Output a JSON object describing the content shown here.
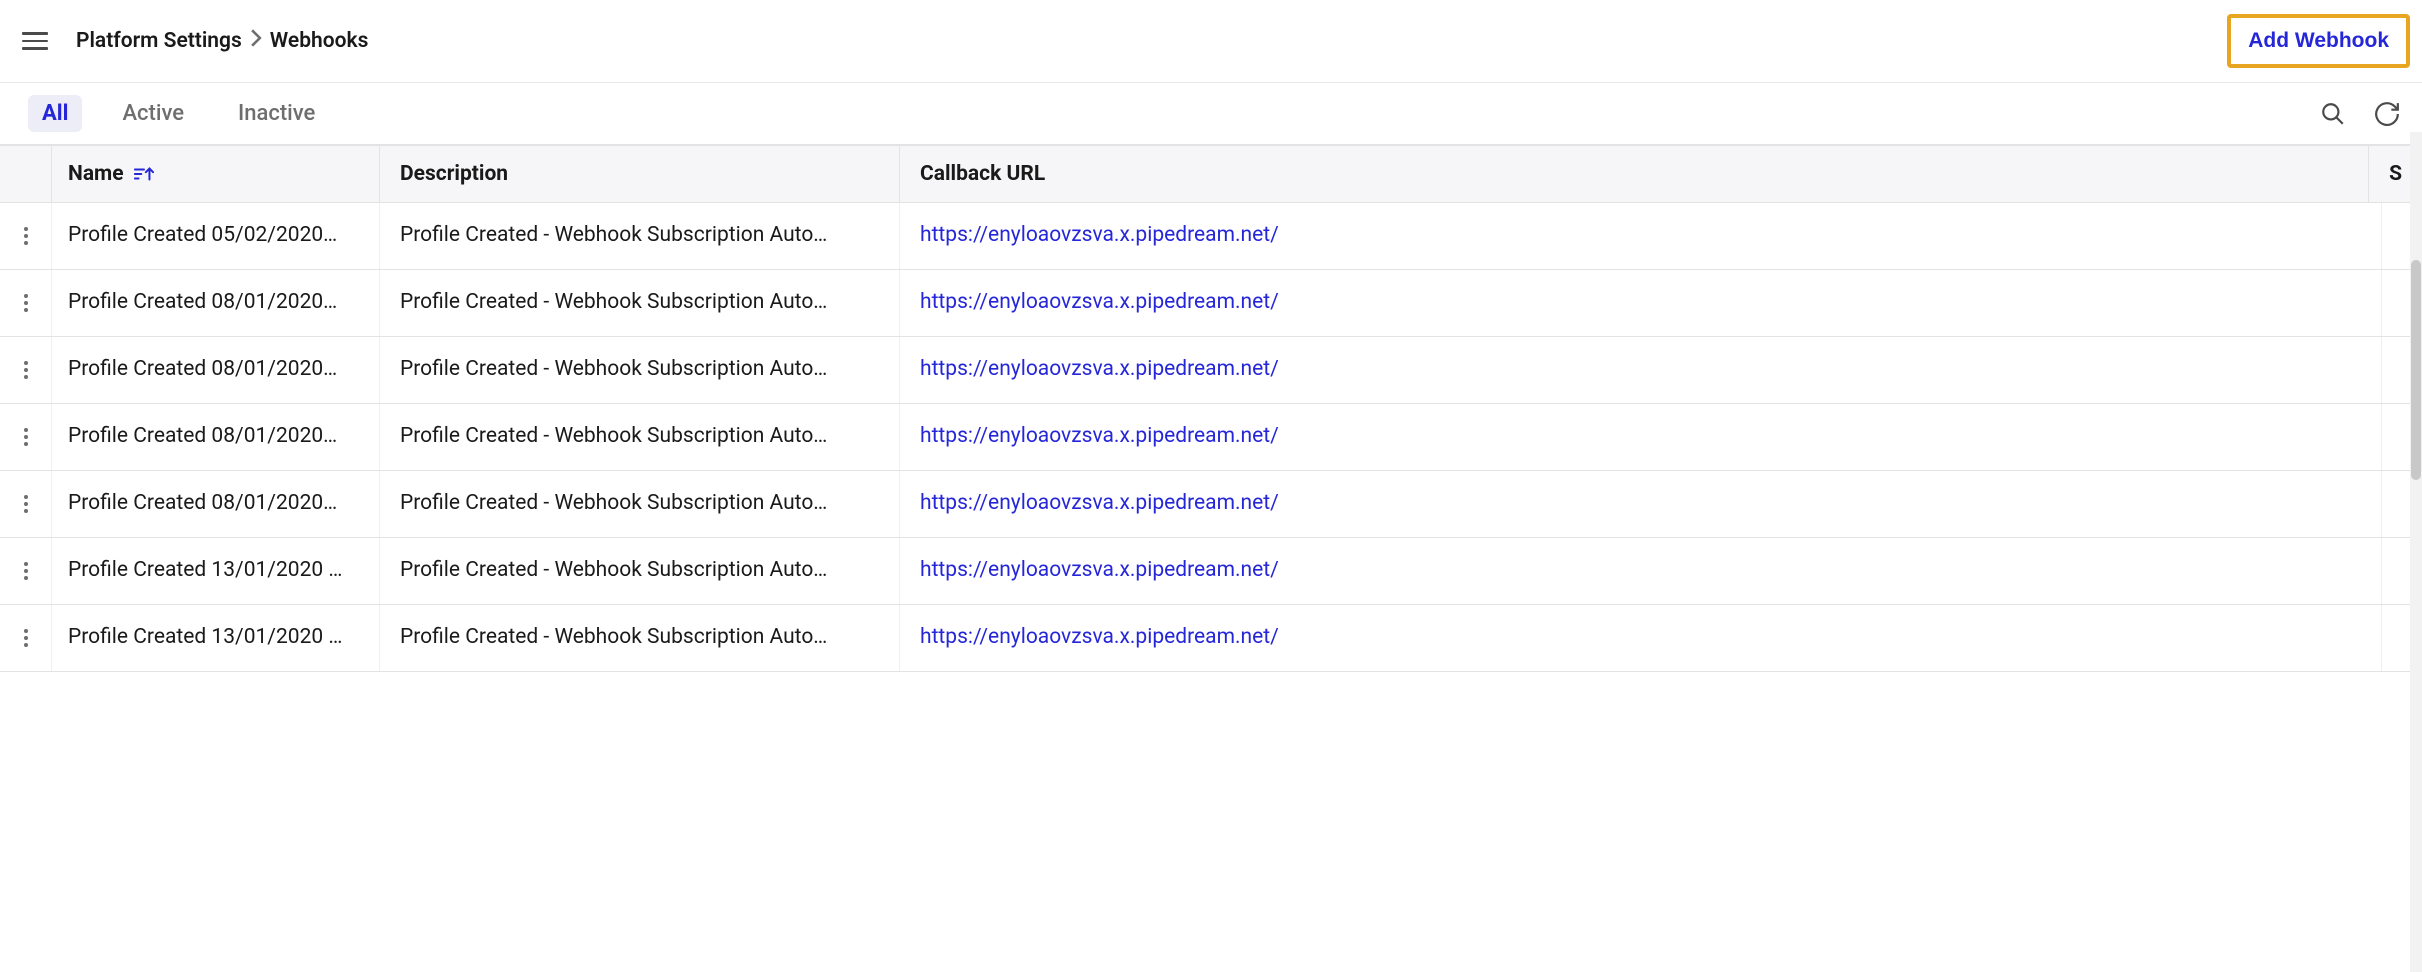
{
  "header": {
    "breadcrumb": [
      "Platform Settings",
      "Webhooks"
    ],
    "add_button_label": "Add Webhook"
  },
  "tabs": {
    "items": [
      {
        "label": "All",
        "active": true
      },
      {
        "label": "Active",
        "active": false
      },
      {
        "label": "Inactive",
        "active": false
      }
    ]
  },
  "columns": {
    "name": "Name",
    "description": "Description",
    "callback_url": "Callback URL",
    "last": "S"
  },
  "rows": [
    {
      "name": "Profile Created 05/02/2020…",
      "description": "Profile Created - Webhook Subscription Auto…",
      "url": "https://enyloaovzsva.x.pipedream.net/"
    },
    {
      "name": "Profile Created 08/01/2020…",
      "description": "Profile Created - Webhook Subscription Auto…",
      "url": "https://enyloaovzsva.x.pipedream.net/"
    },
    {
      "name": "Profile Created 08/01/2020…",
      "description": "Profile Created - Webhook Subscription Auto…",
      "url": "https://enyloaovzsva.x.pipedream.net/"
    },
    {
      "name": "Profile Created 08/01/2020…",
      "description": "Profile Created - Webhook Subscription Auto…",
      "url": "https://enyloaovzsva.x.pipedream.net/"
    },
    {
      "name": "Profile Created 08/01/2020…",
      "description": "Profile Created - Webhook Subscription Auto…",
      "url": "https://enyloaovzsva.x.pipedream.net/"
    },
    {
      "name": "Profile Created 13/01/2020 …",
      "description": "Profile Created - Webhook Subscription Auto…",
      "url": "https://enyloaovzsva.x.pipedream.net/"
    },
    {
      "name": "Profile Created 13/01/2020 …",
      "description": "Profile Created - Webhook Subscription Auto…",
      "url": "https://enyloaovzsva.x.pipedream.net/"
    }
  ]
}
